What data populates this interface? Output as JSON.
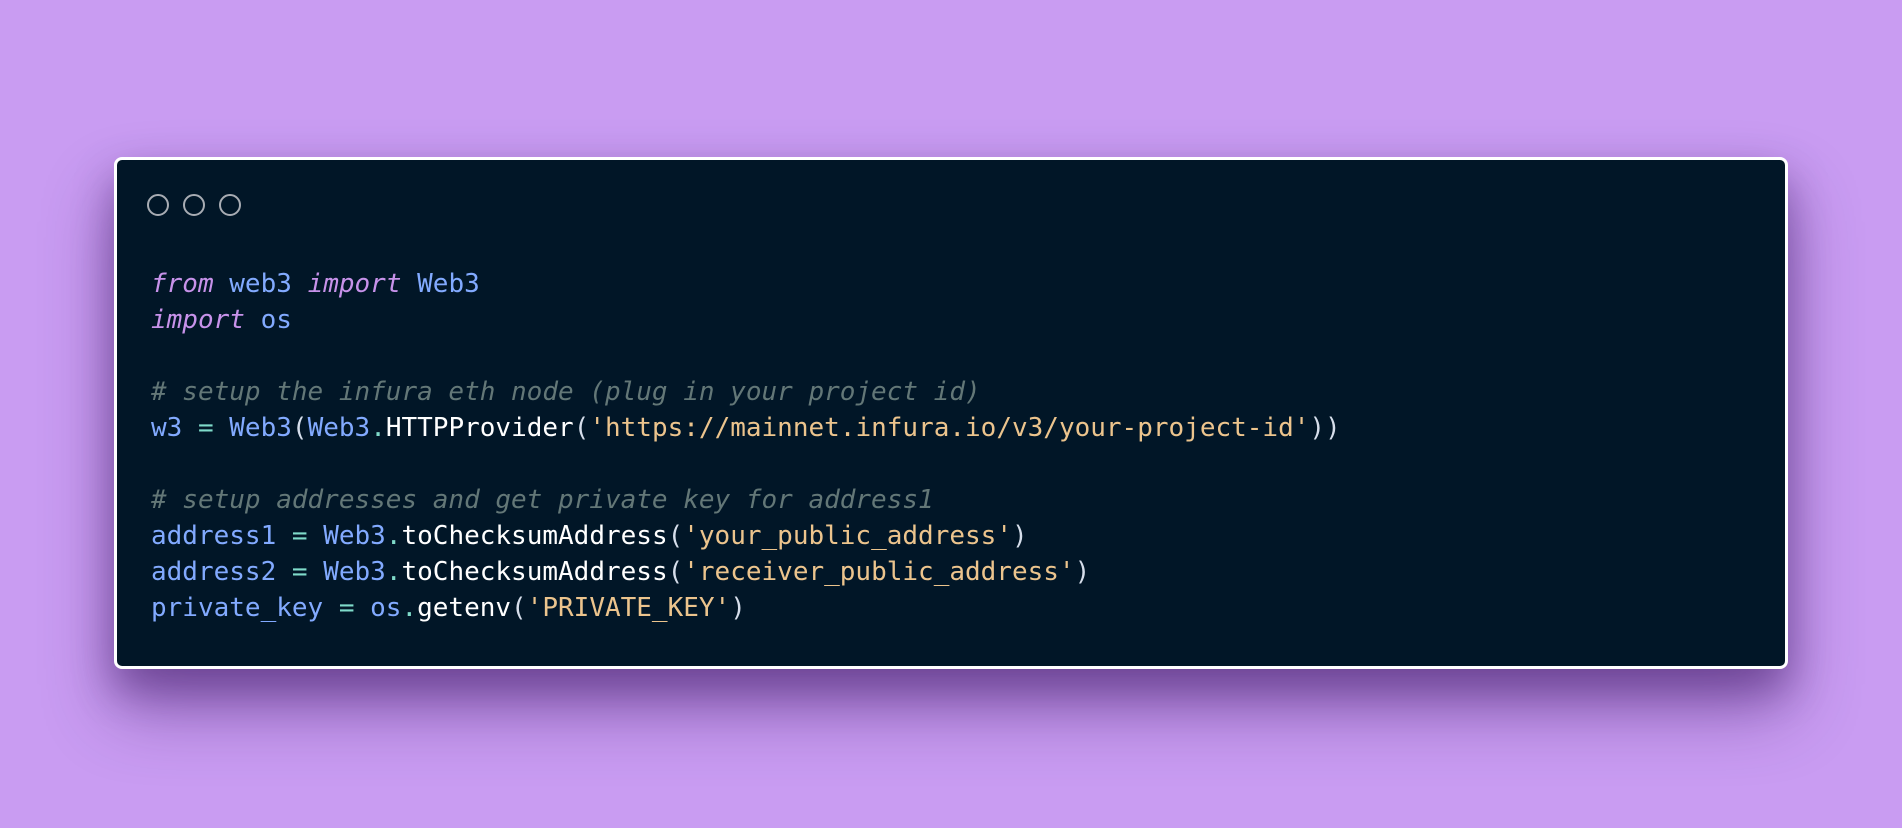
{
  "window": {
    "controls": [
      "circle-icon",
      "circle-icon",
      "circle-icon"
    ]
  },
  "code": {
    "lines": [
      [
        {
          "t": "from",
          "c": "kw"
        },
        {
          "t": " ",
          "c": "plain"
        },
        {
          "t": "web3",
          "c": "var"
        },
        {
          "t": " ",
          "c": "plain"
        },
        {
          "t": "import",
          "c": "kw"
        },
        {
          "t": " ",
          "c": "plain"
        },
        {
          "t": "Web3",
          "c": "var"
        }
      ],
      [
        {
          "t": "import",
          "c": "kw"
        },
        {
          "t": " ",
          "c": "plain"
        },
        {
          "t": "os",
          "c": "var"
        }
      ],
      [],
      [
        {
          "t": "# setup the infura eth node (plug in your project id)",
          "c": "comment"
        }
      ],
      [
        {
          "t": "w3",
          "c": "var"
        },
        {
          "t": " ",
          "c": "plain"
        },
        {
          "t": "=",
          "c": "op"
        },
        {
          "t": " ",
          "c": "plain"
        },
        {
          "t": "Web3",
          "c": "var"
        },
        {
          "t": "(",
          "c": "punc"
        },
        {
          "t": "Web3",
          "c": "var"
        },
        {
          "t": ".",
          "c": "op"
        },
        {
          "t": "HTTPProvider",
          "c": "fn"
        },
        {
          "t": "(",
          "c": "punc"
        },
        {
          "t": "'https://mainnet.infura.io/v3/your-project-id'",
          "c": "str"
        },
        {
          "t": "))",
          "c": "punc"
        }
      ],
      [],
      [
        {
          "t": "# setup addresses and get private key for address1",
          "c": "comment"
        }
      ],
      [
        {
          "t": "address1",
          "c": "var"
        },
        {
          "t": " ",
          "c": "plain"
        },
        {
          "t": "=",
          "c": "op"
        },
        {
          "t": " ",
          "c": "plain"
        },
        {
          "t": "Web3",
          "c": "var"
        },
        {
          "t": ".",
          "c": "op"
        },
        {
          "t": "toChecksumAddress",
          "c": "fn"
        },
        {
          "t": "(",
          "c": "punc"
        },
        {
          "t": "'your_public_address'",
          "c": "str"
        },
        {
          "t": ")",
          "c": "punc"
        }
      ],
      [
        {
          "t": "address2",
          "c": "var"
        },
        {
          "t": " ",
          "c": "plain"
        },
        {
          "t": "=",
          "c": "op"
        },
        {
          "t": " ",
          "c": "plain"
        },
        {
          "t": "Web3",
          "c": "var"
        },
        {
          "t": ".",
          "c": "op"
        },
        {
          "t": "toChecksumAddress",
          "c": "fn"
        },
        {
          "t": "(",
          "c": "punc"
        },
        {
          "t": "'receiver_public_address'",
          "c": "str"
        },
        {
          "t": ")",
          "c": "punc"
        }
      ],
      [
        {
          "t": "private_key",
          "c": "var"
        },
        {
          "t": " ",
          "c": "plain"
        },
        {
          "t": "=",
          "c": "op"
        },
        {
          "t": " ",
          "c": "plain"
        },
        {
          "t": "os",
          "c": "var"
        },
        {
          "t": ".",
          "c": "op"
        },
        {
          "t": "getenv",
          "c": "fn"
        },
        {
          "t": "(",
          "c": "punc"
        },
        {
          "t": "'PRIVATE_KEY'",
          "c": "str"
        },
        {
          "t": ")",
          "c": "punc"
        }
      ]
    ]
  },
  "colors": {
    "background": "#c99cf2",
    "editor_bg": "#011627",
    "keyword": "#c792ea",
    "variable": "#82aaff",
    "string": "#ecc48d",
    "comment": "#637777",
    "operator": "#7fdbca",
    "function": "#ffffff"
  }
}
